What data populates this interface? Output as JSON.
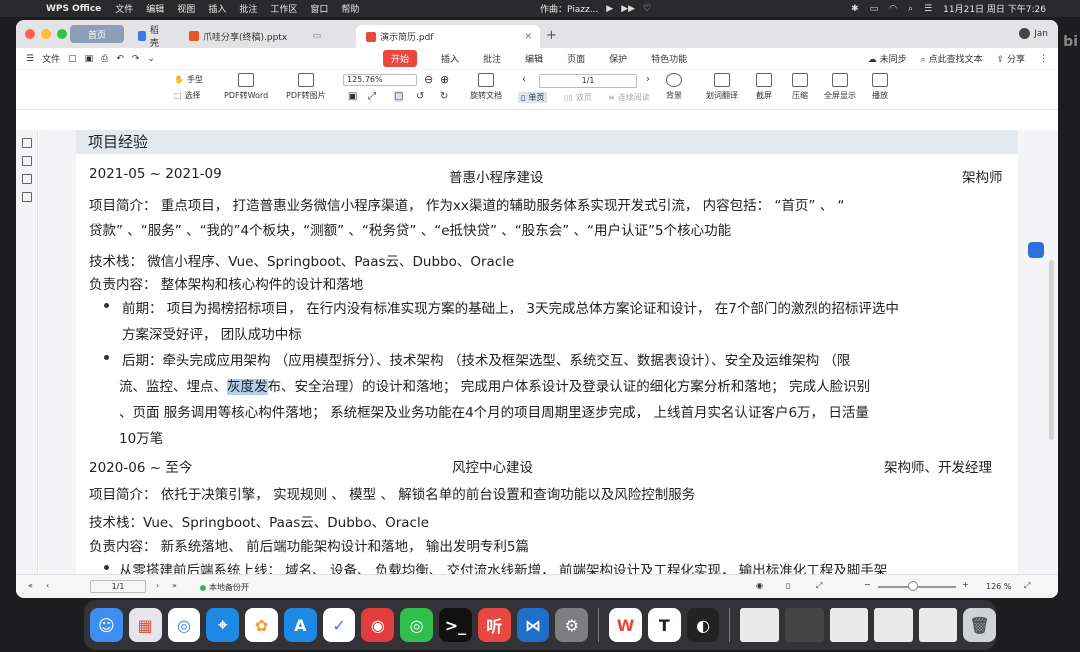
{
  "menubar": {
    "app": "WPS Office",
    "items": [
      "文件",
      "编辑",
      "视图",
      "插入",
      "批注",
      "工作区",
      "窗口",
      "帮助"
    ],
    "now_playing": "作曲：Piazz...",
    "datetime": "11月21日 周日 下午7:26"
  },
  "tabs": {
    "home": "首页",
    "t1": "稻壳",
    "t2": "爪哇分享(终稿).pptx",
    "t3": "演示简历.pdf",
    "user": "Jan"
  },
  "menurow": {
    "file": "文件",
    "tabs": [
      "开始",
      "插入",
      "批注",
      "编辑",
      "页面",
      "保护",
      "特色功能"
    ],
    "sync": "未同步",
    "find": "点此查找文本",
    "share": "分享"
  },
  "toolbar": {
    "hand": "手型",
    "select": "选择",
    "pdf2word": "PDF转Word",
    "pdf2img": "PDF转图片",
    "zoom": "125.76%",
    "rotate": "旋转文档",
    "page": "1/1",
    "single": "单页",
    "double": "双页",
    "continuous": "连续阅读",
    "bg": "背景",
    "translate": "划词翻译",
    "screenshot": "截屏",
    "compress": "压缩",
    "fullscreen": "全屏显示",
    "play": "播放"
  },
  "document": {
    "section_title": "项目经验",
    "p1": {
      "date": "2021-05 ~ 2021-09",
      "name": "普惠小程序建设",
      "role": "架构师",
      "intro1": "项目简介：  重点项目，  打造普惠业务微信小程序渠道，  作为xx渠道的辅助服务体系实现开发式引流，  内容包括：  “首页”  、  “",
      "intro2": "贷款”  、“服务”  、“我的”4个板块，“测额”  、“税务贷”  、“e抵快贷”  、“股东会”  、“用户认证”5个核心功能",
      "stack": "技术栈：  微信小程序、Vue、Springboot、Paas云、Dubbo、Oracle",
      "duty": "负责内容：   整体架构和核心构件的设计和落地",
      "b1_l1": "前期：  项目为揭榜招标项目，  在行内没有标准实现方案的基础上，  3天完成总体方案论证和设计，  在7个部门的激烈的招标评选中",
      "b1_l2": "方案深受好评，  团队成功中标",
      "b2_l1": "后期：牵头完成应用架构  （应用模型拆分）、技术架构  （技术及框架选型、系统交互、数据表设计）、安全及运维架构  （限",
      "b2_l2a": "流、监控、埋点、",
      "b2_l2hl": "灰度发",
      "b2_l2b": "布、安全治理）的设计和落地；  完成用户体系设计及登录认证的细化方案分析和落地；  完成人脸识别",
      "b2_l3": "、页面 服务调用等核心构件落地；   系统框架及业务功能在4个月的项目周期里逐步完成，   上线首月实名认证客户6万，   日活量",
      "b2_l4": "10万笔"
    },
    "p2": {
      "date": "2020-06 ~ 至今",
      "name": "风控中心建设",
      "role": "架构师、开发经理",
      "intro": "项目简介：  依托于决策引擎，  实现规则 、 模型 、 解锁名单的前台设置和查询功能以及风险控制服务",
      "stack": "技术栈：Vue、Springboot、Paas云、Dubbo、Oracle",
      "duty": "负责内容：  新系统落地、 前后端功能架构设计和落地，  输出发明专利5篇",
      "b1": "从零搭建前后端系统上线：  域名、 设备、 负载均衡、 交付流水线新增，  前端架构设计及工程化实现，  输出标准化工程及脚手架"
    }
  },
  "statusbar": {
    "page": "1/1",
    "backup": "本地备份开",
    "zoom": "126 %"
  },
  "edge": "bi"
}
